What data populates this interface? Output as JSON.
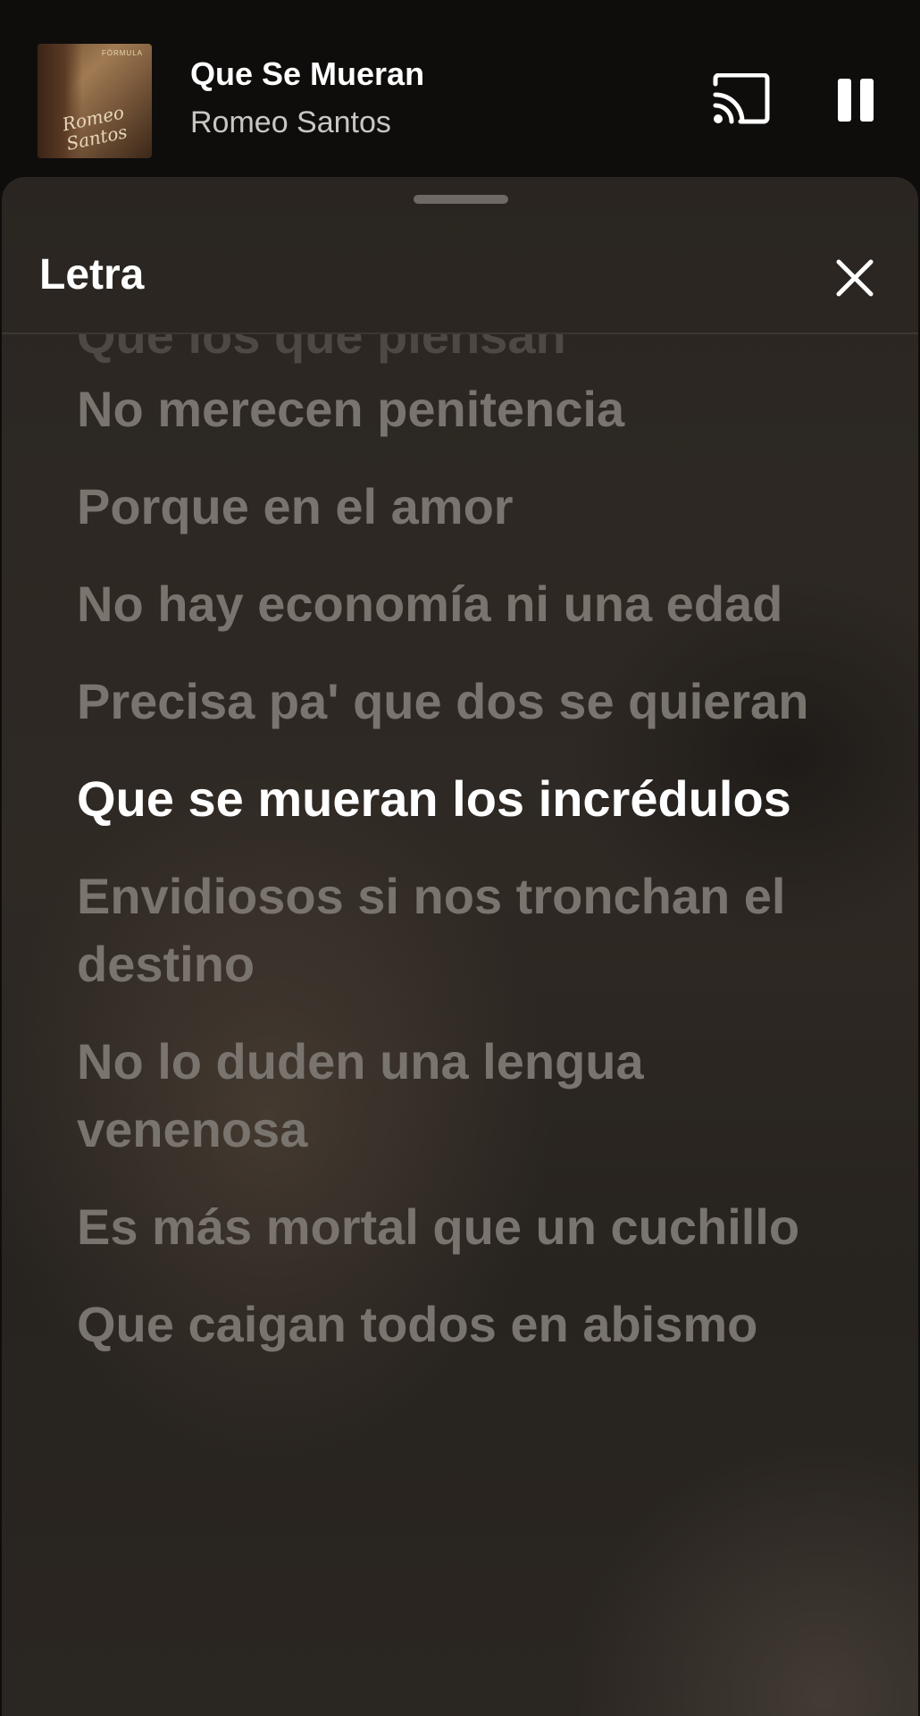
{
  "mini_player": {
    "track_title": "Que Se Mueran",
    "artist": "Romeo Santos",
    "album_art": {
      "script_text": "Romeo Santos",
      "brand_text": "FÓRMULA"
    },
    "cast_icon": "cast-icon",
    "pause_icon": "pause-icon"
  },
  "sheet": {
    "title": "Letra",
    "close_icon": "close-icon",
    "partial_line": "Que los que piensan",
    "lines": [
      {
        "text": "No merecen penitencia",
        "active": false
      },
      {
        "text": "Porque en el amor",
        "active": false
      },
      {
        "text": "No hay economía ni una edad",
        "active": false
      },
      {
        "text": "Precisa pa' que dos se quieran",
        "active": false
      },
      {
        "text": "Que se mueran los incrédulos",
        "active": true
      },
      {
        "text": "Envidiosos si nos tronchan el destino",
        "active": false
      },
      {
        "text": "No lo duden una lengua venenosa",
        "active": false
      },
      {
        "text": "Es más mortal que un cuchillo",
        "active": false
      },
      {
        "text": "Que caigan todos en abismo",
        "active": false
      }
    ]
  },
  "colors": {
    "active_lyric": "#ffffff",
    "inactive_lyric": "#7a746e",
    "background": "#0f0d0c"
  }
}
